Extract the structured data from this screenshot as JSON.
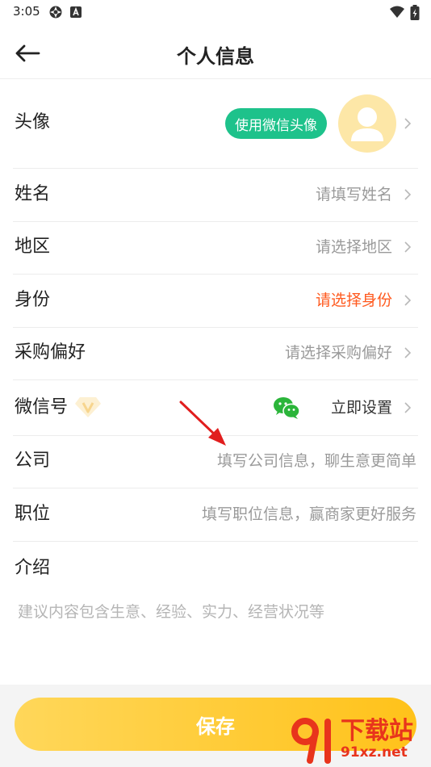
{
  "status_bar": {
    "time": "3:05",
    "icons": [
      "settings-gear-icon",
      "notification-a-icon",
      "wifi-icon",
      "battery-icon"
    ]
  },
  "header": {
    "title": "个人信息",
    "back_icon": "arrow-left-icon"
  },
  "avatar_row": {
    "label": "头像",
    "wechat_avatar_button": "使用微信头像",
    "avatar_icon": "user-avatar-placeholder-icon"
  },
  "rows": {
    "name": {
      "label": "姓名",
      "value": "请填写姓名"
    },
    "region": {
      "label": "地区",
      "value": "请选择地区"
    },
    "identity": {
      "label": "身份",
      "value": "请选择身份"
    },
    "purchase_preference": {
      "label": "采购偏好",
      "value": "请选择采购偏好"
    },
    "wechat_id": {
      "label": "微信号",
      "value": "立即设置",
      "badge_icon": "vip-diamond-icon",
      "value_icon": "wechat-icon"
    },
    "company": {
      "label": "公司",
      "placeholder": "填写公司信息，聊生意更简单"
    },
    "position": {
      "label": "职位",
      "placeholder": "填写职位信息，赢商家更好服务"
    }
  },
  "intro": {
    "label": "介绍",
    "placeholder": "建议内容包含生意、经验、实力、经营状况等"
  },
  "footer": {
    "save_label": "保存"
  },
  "watermark": {
    "brand": "下载站",
    "url": "91xz.net"
  },
  "colors": {
    "accent_green": "#1ec28b",
    "accent_orange": "#ff5a1f",
    "save_yellow": "#ffc21a",
    "watermark_red": "#e8341c"
  }
}
